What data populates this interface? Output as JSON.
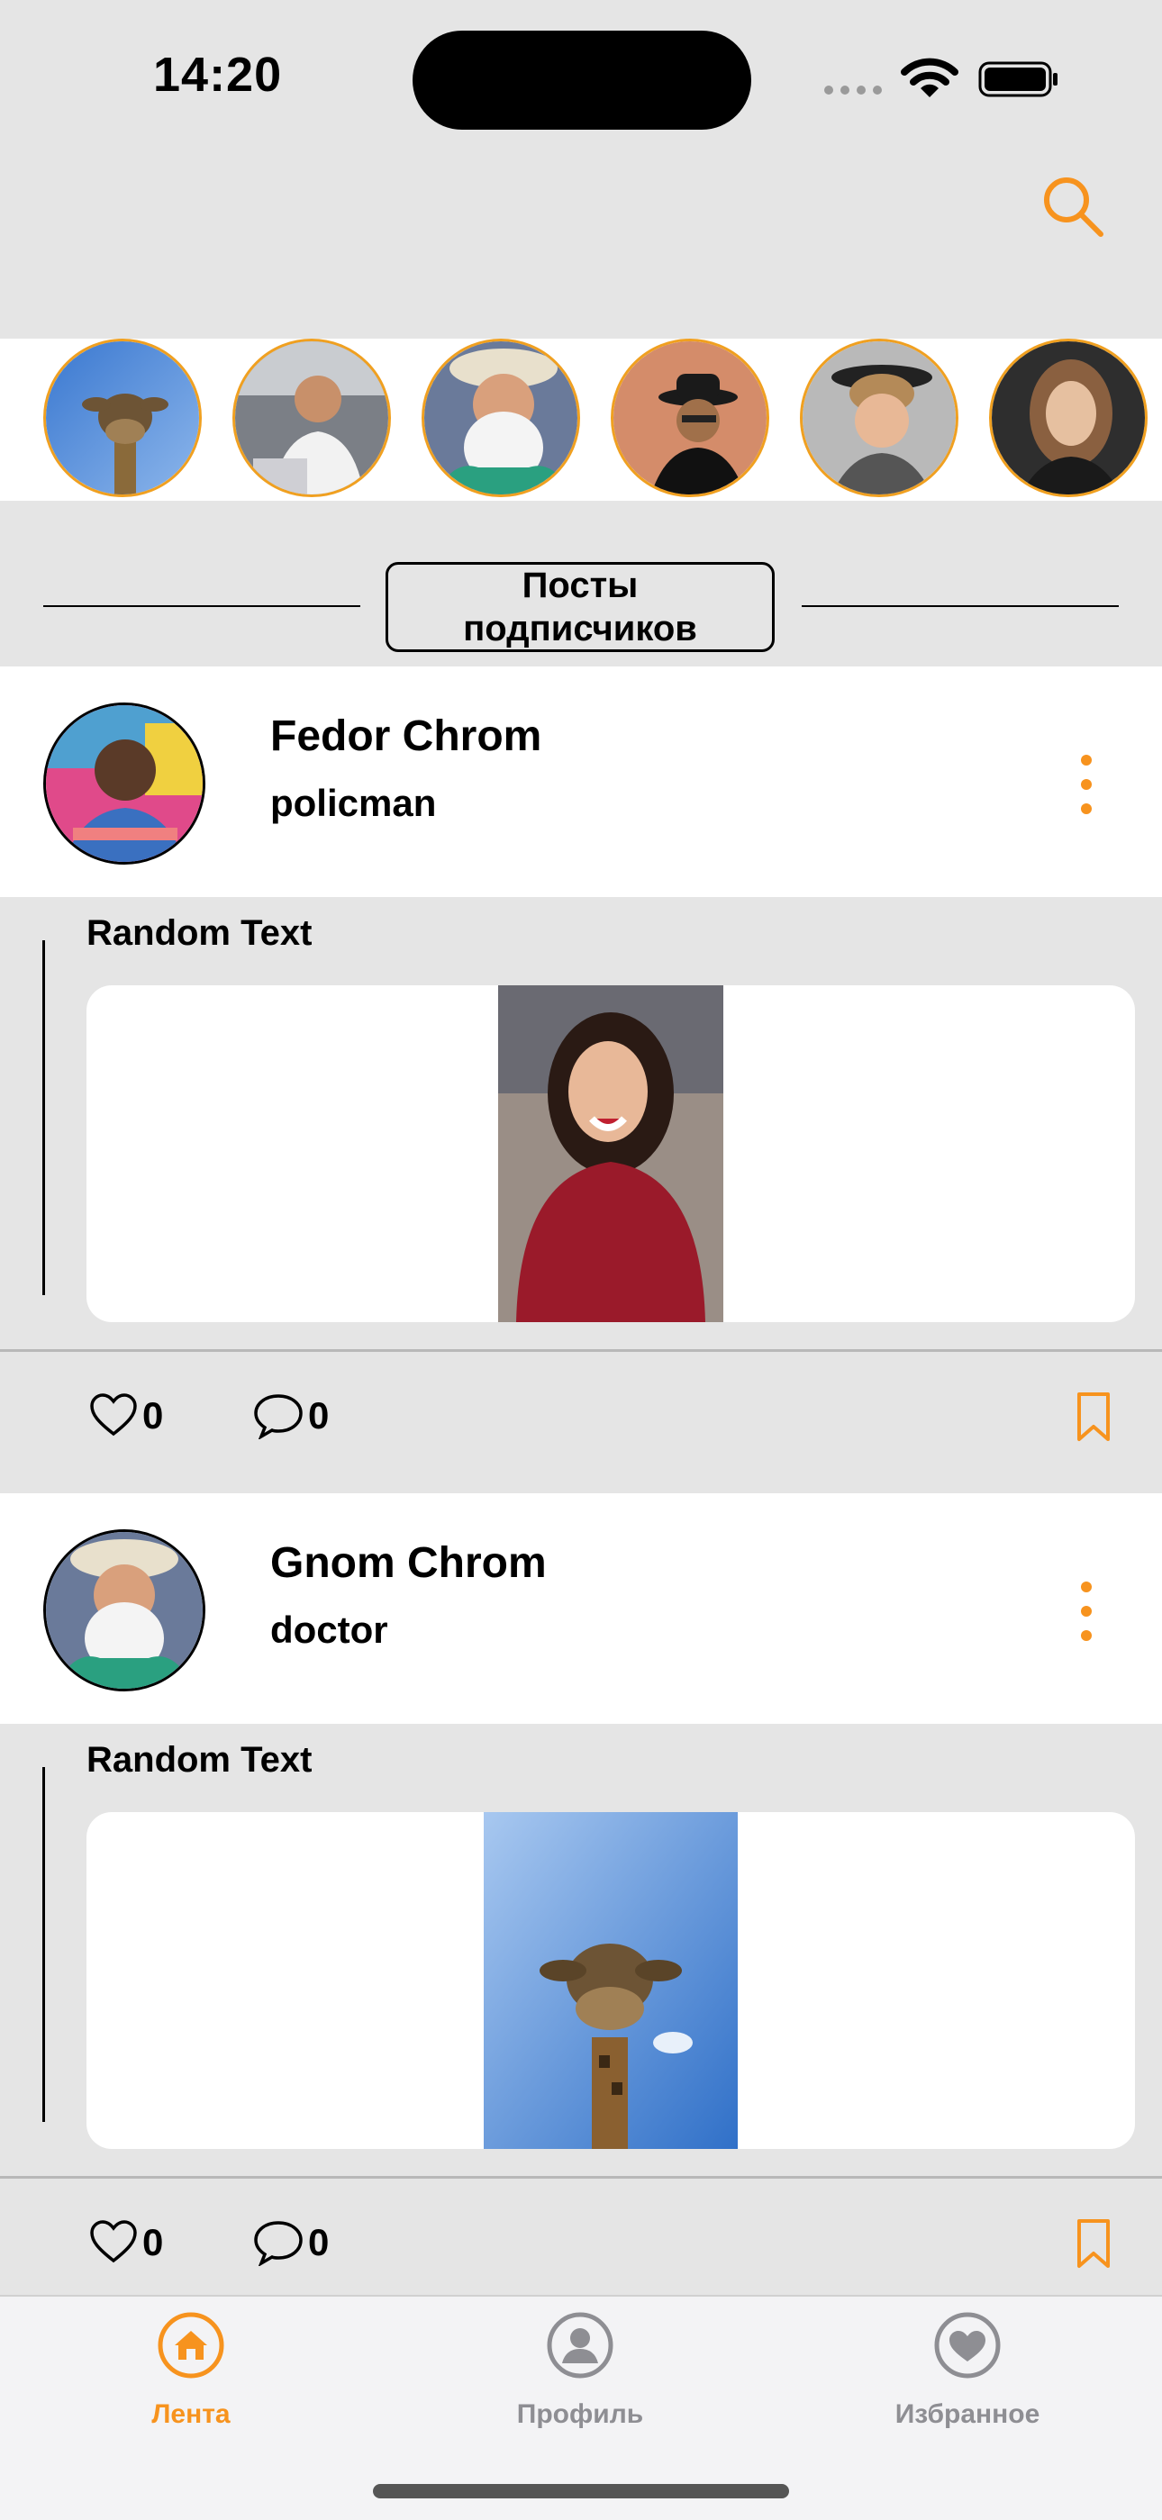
{
  "status_bar": {
    "time": "14:20"
  },
  "colors": {
    "accent": "#F7931E",
    "inactive": "#8E8E93",
    "background": "#E5E5E5"
  },
  "stories": [
    {
      "label": "giraffe"
    },
    {
      "label": "man-office"
    },
    {
      "label": "bearded-man"
    },
    {
      "label": "man-hat-sunglasses"
    },
    {
      "label": "young-man-hat"
    },
    {
      "label": "woman-dark"
    }
  ],
  "section": {
    "title_line1": "Посты",
    "title_line2": "подписчиков"
  },
  "posts": [
    {
      "author": "Fedor Chrom",
      "role": "policman",
      "text": "Random Text",
      "likes": "0",
      "comments": "0"
    },
    {
      "author": "Gnom Chrom",
      "role": "doctor",
      "text": "Random Text",
      "likes": "0",
      "comments": "0"
    }
  ],
  "tabbar": {
    "items": [
      {
        "label": "Лента",
        "icon": "home-icon",
        "active": true
      },
      {
        "label": "Профиль",
        "icon": "person-icon",
        "active": false
      },
      {
        "label": "Избранное",
        "icon": "heart-icon",
        "active": false
      }
    ]
  }
}
